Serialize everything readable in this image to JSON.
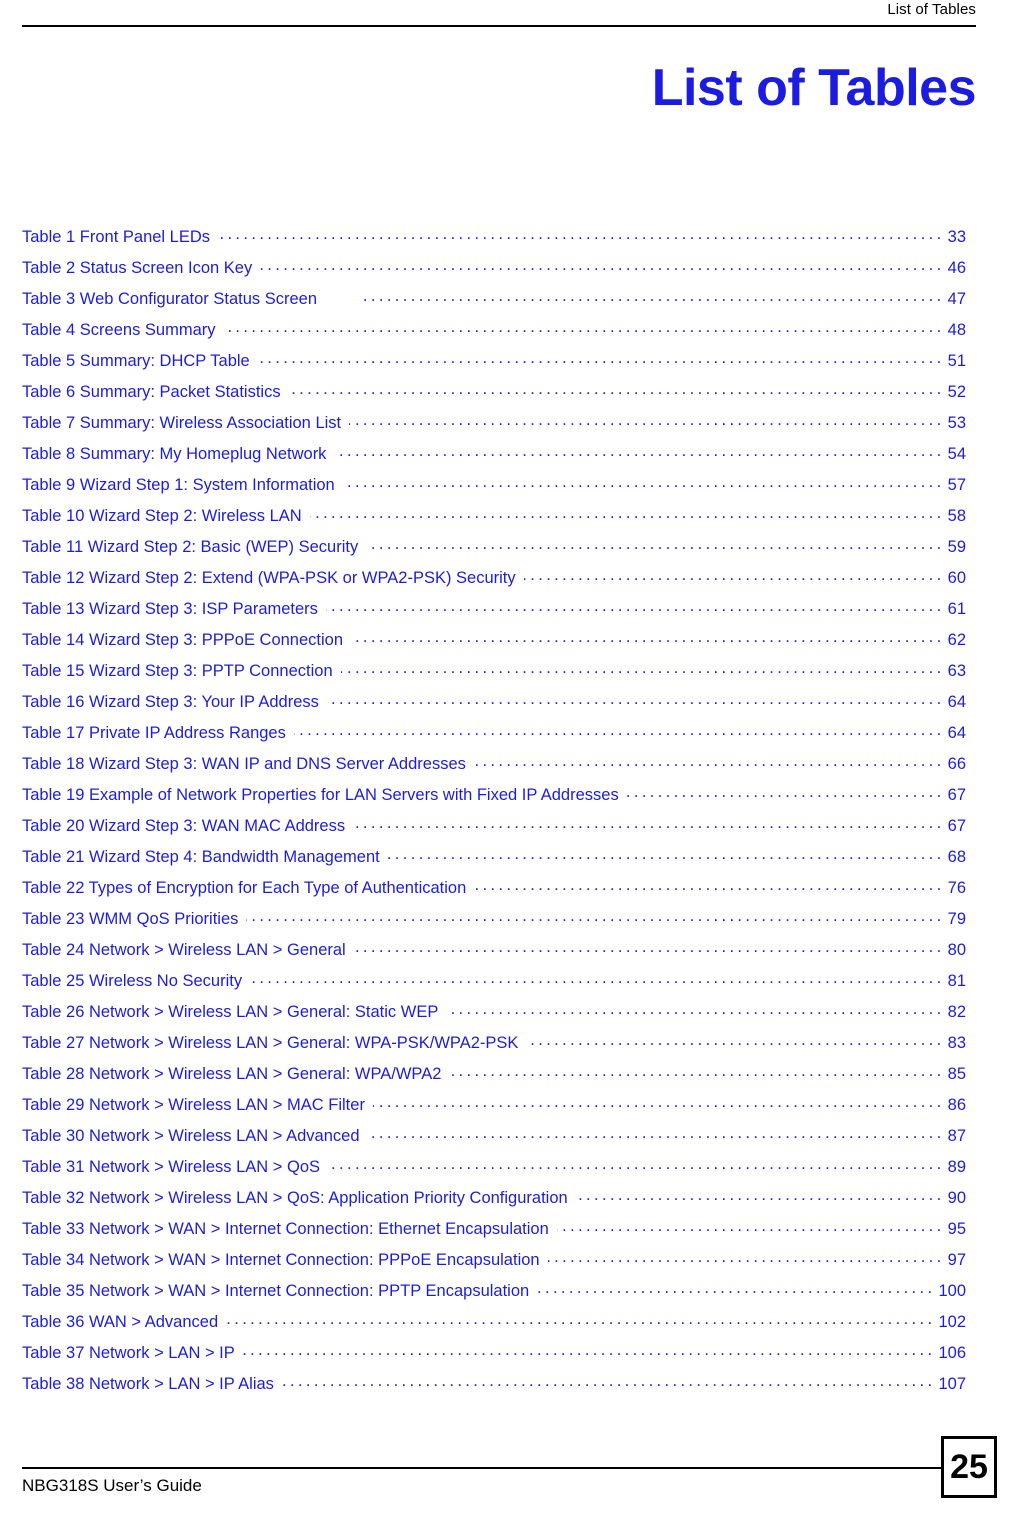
{
  "header": {
    "running_title": "List of Tables"
  },
  "chapter": {
    "title": "List of Tables"
  },
  "colors": {
    "entry_blue": "#1c1ce0",
    "title_blue": "#1c1ce0",
    "text_black": "#000000"
  },
  "toc": {
    "entries": [
      {
        "label": "Table 1 Front Panel LEDs",
        "page": "33",
        "gap": false
      },
      {
        "label": "Table 2 Status Screen Icon Key",
        "page": "46",
        "gap": false
      },
      {
        "label": "Table 3 Web Configurator Status Screen",
        "page": "47",
        "gap": true
      },
      {
        "label": "Table 4 Screens Summary",
        "page": "48",
        "gap": false
      },
      {
        "label": "Table 5 Summary: DHCP Table",
        "page": "51",
        "gap": false
      },
      {
        "label": "Table 6 Summary: Packet Statistics",
        "page": "52",
        "gap": false
      },
      {
        "label": "Table 7 Summary: Wireless Association List",
        "page": "53",
        "gap": false
      },
      {
        "label": "Table 8 Summary: My Homeplug Network",
        "page": "54",
        "gap": false
      },
      {
        "label": "Table 9 Wizard Step 1: System Information",
        "page": "57",
        "gap": false
      },
      {
        "label": "Table 10 Wizard Step 2: Wireless LAN",
        "page": "58",
        "gap": false
      },
      {
        "label": "Table 11 Wizard Step 2: Basic (WEP) Security",
        "page": "59",
        "gap": false
      },
      {
        "label": "Table 12 Wizard Step 2: Extend (WPA-PSK or WPA2-PSK) Security",
        "page": "60",
        "gap": false
      },
      {
        "label": "Table 13 Wizard Step 3: ISP Parameters",
        "page": "61",
        "gap": false
      },
      {
        "label": "Table 14 Wizard Step 3: PPPoE Connection",
        "page": "62",
        "gap": false
      },
      {
        "label": "Table 15 Wizard Step 3: PPTP Connection",
        "page": "63",
        "gap": false
      },
      {
        "label": "Table 16 Wizard Step 3: Your IP Address",
        "page": "64",
        "gap": false
      },
      {
        "label": "Table 17 Private IP Address Ranges",
        "page": "64",
        "gap": false
      },
      {
        "label": "Table 18 Wizard Step 3: WAN IP and DNS Server Addresses",
        "page": "66",
        "gap": false
      },
      {
        "label": "Table 19 Example of Network Properties for LAN Servers with Fixed IP Addresses",
        "page": "67",
        "gap": false
      },
      {
        "label": "Table 20 Wizard Step 3: WAN MAC Address",
        "page": "67",
        "gap": false
      },
      {
        "label": "Table 21 Wizard Step 4: Bandwidth Management",
        "page": "68",
        "gap": false
      },
      {
        "label": "Table 22 Types of Encryption for Each Type of Authentication",
        "page": "76",
        "gap": false
      },
      {
        "label": "Table 23 WMM QoS Priorities",
        "page": "79",
        "gap": false
      },
      {
        "label": "Table 24 Network > Wireless LAN > General",
        "page": "80",
        "gap": false
      },
      {
        "label": "Table 25 Wireless No Security",
        "page": "81",
        "gap": false
      },
      {
        "label": "Table 26 Network > Wireless LAN > General: Static WEP",
        "page": "82",
        "gap": false
      },
      {
        "label": "Table 27 Network > Wireless LAN > General: WPA-PSK/WPA2-PSK",
        "page": "83",
        "gap": false
      },
      {
        "label": "Table 28 Network > Wireless LAN > General: WPA/WPA2",
        "page": "85",
        "gap": false
      },
      {
        "label": "Table 29 Network > Wireless LAN > MAC Filter",
        "page": "86",
        "gap": false
      },
      {
        "label": "Table 30 Network > Wireless LAN > Advanced",
        "page": "87",
        "gap": false
      },
      {
        "label": "Table 31 Network > Wireless LAN > QoS",
        "page": "89",
        "gap": false
      },
      {
        "label": "Table 32 Network > Wireless LAN > QoS: Application Priority Configuration",
        "page": "90",
        "gap": false
      },
      {
        "label": "Table 33 Network > WAN > Internet Connection: Ethernet Encapsulation",
        "page": "95",
        "gap": false
      },
      {
        "label": "Table 34 Network > WAN > Internet Connection: PPPoE Encapsulation",
        "page": "97",
        "gap": false
      },
      {
        "label": "Table 35 Network > WAN > Internet Connection: PPTP Encapsulation",
        "page": "100",
        "gap": false
      },
      {
        "label": "Table 36 WAN > Advanced",
        "page": "102",
        "gap": false
      },
      {
        "label": "Table 37 Network > LAN > IP",
        "page": "106",
        "gap": false
      },
      {
        "label": "Table 38 Network > LAN > IP Alias",
        "page": "107",
        "gap": false
      }
    ]
  },
  "footer": {
    "guide_name": "NBG318S User’s Guide",
    "page_number": "25"
  }
}
